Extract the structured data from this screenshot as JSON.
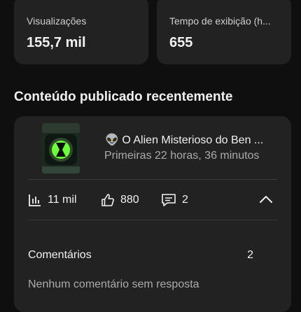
{
  "stats": [
    {
      "label": "Visualizações",
      "value": "155,7 mil"
    },
    {
      "label": "Tempo de exibição (h...",
      "value": "655"
    }
  ],
  "section": {
    "title": "Conteúdo publicado recentemente"
  },
  "video": {
    "title_emoji": "👽",
    "title": "O Alien Misterioso do Ben ...",
    "subtitle": "Primeiras 22 horas, 36 minutos",
    "views": "11 mil",
    "likes": "880",
    "comments": "2"
  },
  "comments_section": {
    "label": "Comentários",
    "count": "2",
    "empty_text": "Nenhum comentário sem resposta"
  },
  "icons": {
    "views": "bar-chart-icon",
    "likes": "thumb-up-icon",
    "comments": "comment-icon",
    "collapse": "chevron-up-icon"
  },
  "colors": {
    "background": "#0f0f0f",
    "card": "#222222",
    "muted_text": "#aaaaaa",
    "thumb_accent": "#6dff3a"
  }
}
